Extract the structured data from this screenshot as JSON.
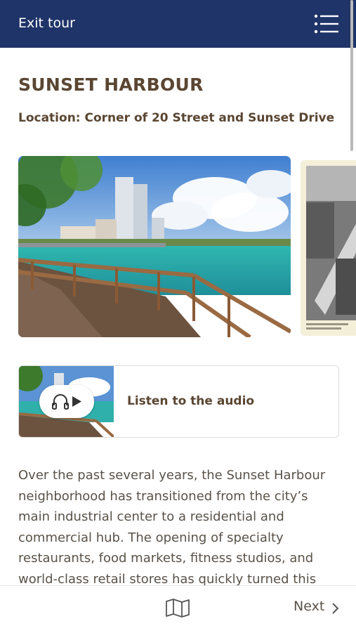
{
  "header": {
    "exit_label": "Exit tour",
    "menu_icon": "menu-icon",
    "background": "#1f3468"
  },
  "stop": {
    "title": "SUNSET HARBOUR",
    "location": "Location: Corner of 20 Street and Sunset Drive"
  },
  "gallery": {
    "images": [
      "harbour-photo",
      "historic-aerial-photo"
    ]
  },
  "audio": {
    "label": "Listen to the audio",
    "icon": "headphones-icon"
  },
  "description": "Over the past several years, the Sunset Harbour neighborhood has transitioned from the city’s main industrial center to a residential and commercial hub. The opening of specialty restaurants, food markets, fitness studios, and world-class retail stores has quickly turned this neighborhood into a",
  "footer": {
    "map_icon": "map-icon",
    "next_label": "Next"
  },
  "colors": {
    "brand": "#1f3468",
    "heading": "#5a4632",
    "text": "#5a5249"
  }
}
